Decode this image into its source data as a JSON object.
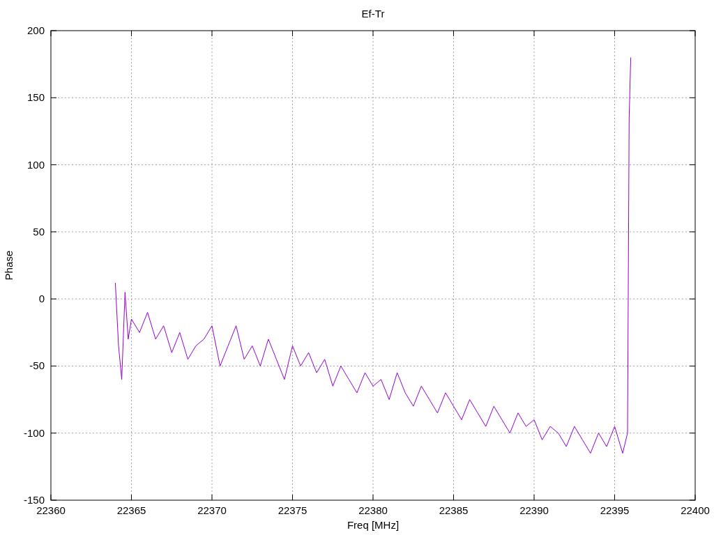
{
  "chart_data": {
    "type": "line",
    "title": "Ef-Tr",
    "xlabel": "Freq [MHz]",
    "ylabel": "Phase",
    "xlim": [
      22360,
      22400
    ],
    "ylim": [
      -150,
      200
    ],
    "xticks": [
      22360,
      22365,
      22370,
      22375,
      22380,
      22385,
      22390,
      22395,
      22400
    ],
    "yticks": [
      -150,
      -100,
      -50,
      0,
      50,
      100,
      150,
      200
    ],
    "x": [
      22364.0,
      22364.2,
      22364.4,
      22364.6,
      22364.8,
      22365.0,
      22365.5,
      22366.0,
      22366.5,
      22367.0,
      22367.5,
      22368.0,
      22368.5,
      22369.0,
      22369.5,
      22370.0,
      22370.5,
      22371.0,
      22371.5,
      22372.0,
      22372.5,
      22373.0,
      22373.5,
      22374.0,
      22374.5,
      22375.0,
      22375.5,
      22376.0,
      22376.5,
      22377.0,
      22377.5,
      22378.0,
      22378.5,
      22379.0,
      22379.5,
      22380.0,
      22380.5,
      22381.0,
      22381.5,
      22382.0,
      22382.5,
      22383.0,
      22383.5,
      22384.0,
      22384.5,
      22385.0,
      22385.5,
      22386.0,
      22386.5,
      22387.0,
      22387.5,
      22388.0,
      22388.5,
      22389.0,
      22389.5,
      22390.0,
      22390.5,
      22391.0,
      22391.5,
      22392.0,
      22392.5,
      22393.0,
      22393.5,
      22394.0,
      22394.5,
      22395.0,
      22395.5,
      22395.8,
      22395.9,
      22396.0
    ],
    "grid": true,
    "series": [
      {
        "color": "#9400d3",
        "values": [
          12,
          -35,
          -60,
          5,
          -30,
          -15,
          -25,
          -10,
          -30,
          -20,
          -40,
          -25,
          -45,
          -35,
          -30,
          -20,
          -50,
          -35,
          -20,
          -45,
          -35,
          -50,
          -30,
          -45,
          -60,
          -35,
          -50,
          -40,
          -55,
          -45,
          -65,
          -50,
          -60,
          -70,
          -55,
          -65,
          -60,
          -75,
          -55,
          -70,
          -80,
          -65,
          -75,
          -85,
          -70,
          -80,
          -90,
          -75,
          -85,
          -95,
          -80,
          -90,
          -100,
          -85,
          -95,
          -90,
          -105,
          -95,
          -100,
          -110,
          -95,
          -105,
          -115,
          -100,
          -110,
          -95,
          -115,
          -100,
          135,
          180
        ]
      }
    ]
  }
}
